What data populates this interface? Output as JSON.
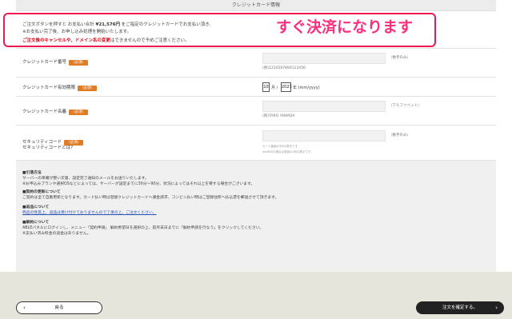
{
  "section": {
    "title": "クレジットカード情報"
  },
  "notice": {
    "line1_pre": "ご注文ボタンを押すと お支払い合計 ",
    "line1_price": "¥21,576円",
    "line1_post": " をご指定のクレジットカードでお支払い頂き、",
    "line2": "※お支払い完了後、お申し込み処理を開始いたします。",
    "line3_red1": "ご注文後のキャンセルや、ドメイン名の変更",
    "line3_post": "はできませんので予めご注意ください。"
  },
  "callout": {
    "text": "すぐ決済になります"
  },
  "form": {
    "required_badge": "（必須）",
    "card_number": {
      "label": "クレジットカード番号",
      "hint": "（数字のみ）",
      "example": "(例)1234567890123456"
    },
    "expiry": {
      "label": "クレジットカード有効期限",
      "month": "10",
      "month_unit": "月 /",
      "year": "2023",
      "year_unit": "年 (mm/yyyy)"
    },
    "card_name": {
      "label": "クレジットカード名義",
      "hint": "（アルファベット）",
      "example": "(例)TARO YAMADA"
    },
    "security": {
      "label": "セキュリティコード",
      "label2": "セキュリティコードとは?",
      "hint": "（数字のみ）",
      "note1": "カード裏面の3桁の数字です",
      "note2": "※AMEXの場合は表面の4桁の数字です"
    }
  },
  "info": {
    "h1": "■引落方法",
    "p1a": "サーバーの準備が整い次第、設定完了通知のメールをお送りいたします。",
    "p1b": "※お申込みプランや選択OSなどによっては、サーバーが設定までに30分〜90分、状況によってはそれ以上を要する場合がございます。",
    "h2": "■契約の更新について",
    "p2": "ご契約は全て自動更新となります。カード払い時は登録クレジットカードへ課金請求、コンビニ払い時はご登録住所へ払込票を郵送させて頂きます。",
    "h3": "■返品について",
    "p3": "商品の性質上、返品は受け付けておりませんので了承の上、ご注文ください。",
    "h4": "■解約について",
    "p4a": "ABLEパネルにログインし、メニュー「契約申請」 解約希望日を選択の上、前月末日までに「解約申請を行なう」をクリックしてください。",
    "p4b": "※支払い済み料金の返金はありません。"
  },
  "buttons": {
    "back_label": "戻る",
    "confirm_label": "注文を確定する。"
  }
}
